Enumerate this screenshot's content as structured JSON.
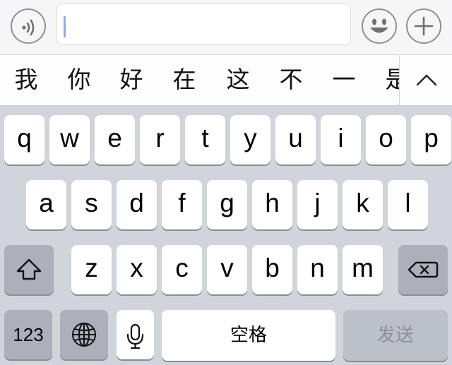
{
  "input_bar": {
    "text_value": "",
    "voice_icon": "voice-wave-icon",
    "emoji_icon": "smiley-face-icon",
    "plus_icon": "plus-icon"
  },
  "candidates": {
    "items": [
      "我",
      "你",
      "好",
      "在",
      "这",
      "不",
      "一",
      "是"
    ],
    "expand_icon": "chevron-up-icon"
  },
  "keyboard": {
    "row1": [
      "q",
      "w",
      "e",
      "r",
      "t",
      "y",
      "u",
      "i",
      "o",
      "p"
    ],
    "row2": [
      "a",
      "s",
      "d",
      "f",
      "g",
      "h",
      "j",
      "k",
      "l"
    ],
    "row3": [
      "z",
      "x",
      "c",
      "v",
      "b",
      "n",
      "m"
    ],
    "shift_icon": "shift-arrow-icon",
    "backspace_icon": "backspace-icon",
    "numbers_label": "123",
    "globe_icon": "globe-icon",
    "mic_icon": "microphone-icon",
    "space_label": "空格",
    "send_label": "发送"
  },
  "colors": {
    "keyboard_bg": "#d1d4db",
    "key_bg": "#ffffff",
    "function_key_bg": "#abb0ba",
    "caret": "#8fa8e8",
    "send_text_disabled": "#8c8f96"
  }
}
